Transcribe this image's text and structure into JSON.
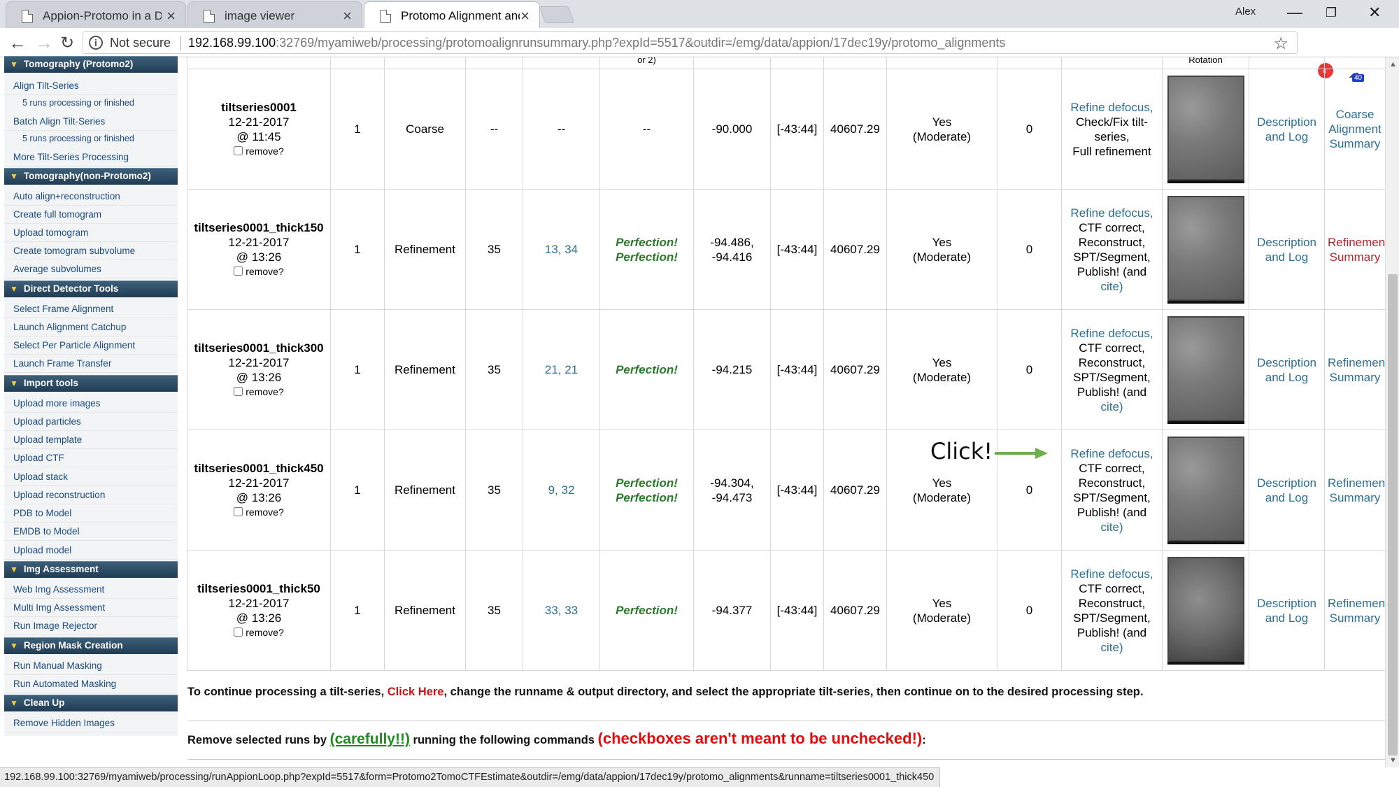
{
  "browser": {
    "tabs": [
      {
        "title": "Appion-Protomo in a Do"
      },
      {
        "title": "image viewer"
      },
      {
        "title": "Protomo Alignment and"
      }
    ],
    "profile_name": "Alex",
    "security_label": "Not secure",
    "url_host": "192.168.99.100",
    "url_rest": ":32769/myamiweb/processing/protomoalignrunsummary.php?expId=5517&outdir=/emg/data/appion/17dec19y/protomo_alignments",
    "extension_badge": "40",
    "status_url": "192.168.99.100:32769/myamiweb/processing/runAppionLoop.php?expId=5517&form=Protomo2TomoCTFEstimate&outdir=/emg/data/appion/17dec19y/protomo_alignments&runname=tiltseries0001_thick450"
  },
  "sidebar": {
    "sections": [
      {
        "title": "Tomography (Protomo2)"
      },
      {
        "title": "Tomography(non-Protomo2)"
      },
      {
        "title": "Direct Detector Tools"
      },
      {
        "title": "Import tools"
      },
      {
        "title": "Img Assessment"
      },
      {
        "title": "Region Mask Creation"
      },
      {
        "title": "Clean Up"
      }
    ],
    "items": {
      "align_tilt_series": "Align Tilt-Series",
      "align_sub": "5 runs processing or finished",
      "batch_align": "Batch Align Tilt-Series",
      "batch_sub": "5 runs processing or finished",
      "more_tilt": "More Tilt-Series Processing",
      "auto_align": "Auto align+reconstruction",
      "create_full": "Create full tomogram",
      "upload_tomogram": "Upload tomogram",
      "create_subvolume": "Create tomogram subvolume",
      "average_subvolumes": "Average subvolumes",
      "select_frame": "Select Frame Alignment",
      "launch_catchup": "Launch Alignment Catchup",
      "select_per_particle": "Select Per Particle Alignment",
      "launch_frame_transfer": "Launch Frame Transfer",
      "upload_more_images": "Upload more images",
      "upload_particles": "Upload particles",
      "upload_template": "Upload template",
      "upload_ctf": "Upload CTF",
      "upload_stack": "Upload stack",
      "upload_reconstruction": "Upload reconstruction",
      "pdb_to_model": "PDB to Model",
      "emdb_to_model": "EMDB to Model",
      "upload_model": "Upload model",
      "web_img": "Web Img Assessment",
      "multi_img": "Multi Img Assessment",
      "run_rejector": "Run Image Rejector",
      "run_manual_masking": "Run Manual Masking",
      "run_auto_masking": "Run Automated Masking",
      "remove_hidden": "Remove Hidden Images"
    }
  },
  "table": {
    "partial_header": {
      "iterations": "or 2)",
      "image": "Rotation"
    },
    "remove_label": "remove?",
    "moderate_label": "(Moderate)",
    "description_line1": "Description",
    "description_line2": "and Log",
    "rows": [
      {
        "name": "tiltseries0001",
        "date": "12-21-2017",
        "time": "@ 11:45",
        "count": "1",
        "type": "Coarse",
        "iterations": "--",
        "best": "--",
        "quality": "--",
        "angle": "-90.000",
        "range": "[-43:44]",
        "value": "40607.29",
        "yes": "Yes",
        "zero": "0",
        "actions": [
          "Refine defocus,",
          "Check/Fix tilt-",
          "series,",
          "Full refinement"
        ],
        "summary": [
          "Coarse",
          "Alignment",
          "Summary"
        ]
      },
      {
        "name": "tiltseries0001_thick150",
        "date": "12-21-2017",
        "time": "@ 13:26",
        "count": "1",
        "type": "Refinement",
        "iterations": "35",
        "best": "13, 34",
        "quality": [
          "Perfection!",
          "Perfection!"
        ],
        "angle": [
          "-94.486,",
          "-94.416"
        ],
        "range": "[-43:44]",
        "value": "40607.29",
        "yes": "Yes",
        "zero": "0",
        "actions": [
          "Refine defocus,",
          "CTF correct,",
          "Reconstruct,",
          "SPT/Segment,",
          "Publish! (and",
          "cite)"
        ],
        "summary": [
          "Refinement",
          "Summary"
        ]
      },
      {
        "name": "tiltseries0001_thick300",
        "date": "12-21-2017",
        "time": "@ 13:26",
        "count": "1",
        "type": "Refinement",
        "iterations": "35",
        "best": "21, 21",
        "quality": [
          "Perfection!"
        ],
        "angle": [
          "-94.215"
        ],
        "range": "[-43:44]",
        "value": "40607.29",
        "yes": "Yes",
        "zero": "0",
        "actions": [
          "Refine defocus,",
          "CTF correct,",
          "Reconstruct,",
          "SPT/Segment,",
          "Publish! (and",
          "cite)"
        ],
        "summary": [
          "Refinement",
          "Summary"
        ]
      },
      {
        "name": "tiltseries0001_thick450",
        "date": "12-21-2017",
        "time": "@ 13:26",
        "count": "1",
        "type": "Refinement",
        "iterations": "35",
        "best": "9, 32",
        "quality": [
          "Perfection!",
          "Perfection!"
        ],
        "angle": [
          "-94.304,",
          "-94.473"
        ],
        "range": "[-43:44]",
        "value": "40607.29",
        "yes": "Yes",
        "zero": "0",
        "actions": [
          "Refine defocus,",
          "CTF correct,",
          "Reconstruct,",
          "SPT/Segment,",
          "Publish! (and",
          "cite)"
        ],
        "summary": [
          "Refinement",
          "Summary"
        ]
      },
      {
        "name": "tiltseries0001_thick50",
        "date": "12-21-2017",
        "time": "@ 13:26",
        "count": "1",
        "type": "Refinement",
        "iterations": "35",
        "best": "33, 33",
        "quality": [
          "Perfection!"
        ],
        "angle": [
          "-94.377"
        ],
        "range": "[-43:44]",
        "value": "40607.29",
        "yes": "Yes",
        "zero": "0",
        "actions": [
          "Refine defocus,",
          "CTF correct,",
          "Reconstruct,",
          "SPT/Segment,",
          "Publish! (and",
          "cite)"
        ],
        "summary": [
          "Refinement",
          "Summary"
        ]
      }
    ]
  },
  "annotation": {
    "click_label": "Click!",
    "arrow_color": "#6ab04c"
  },
  "footer": {
    "continue_pre": "To continue processing a tilt-series, ",
    "continue_link": "Click Here",
    "continue_post": ", change the runname & output directory, and select the appropriate tilt-series, then continue on to the desired processing step.",
    "remove_pre": "Remove selected runs by ",
    "remove_careful": "(carefully!!)",
    "remove_mid": " running the following commands ",
    "remove_warning": "(checkboxes aren't meant to be unchecked!)",
    "remove_post": ":"
  }
}
